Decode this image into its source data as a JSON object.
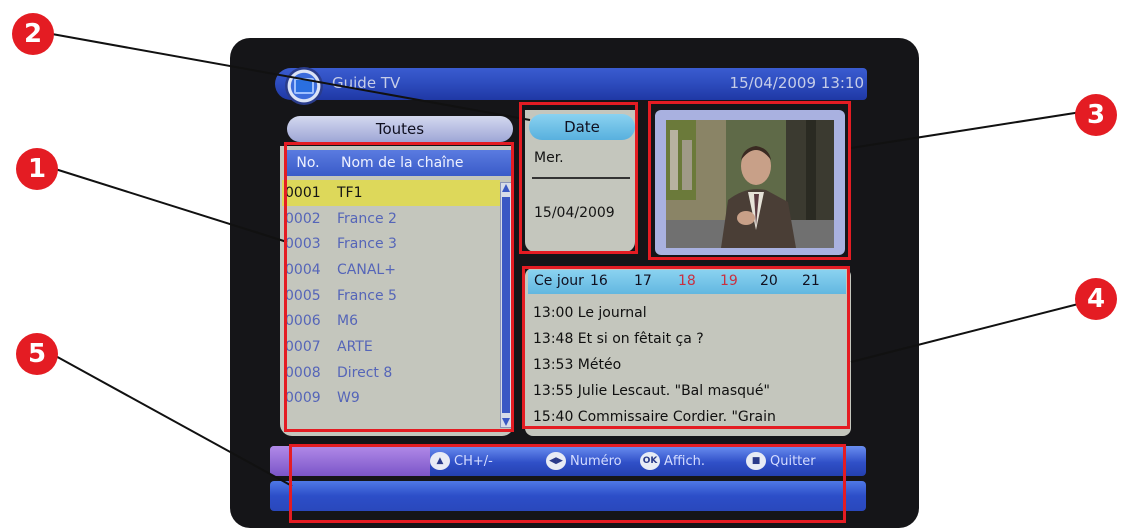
{
  "header": {
    "title": "Guide TV",
    "datetime": "15/04/2009  13:10"
  },
  "filter": {
    "label": "Toutes"
  },
  "channel_list": {
    "columns": [
      "No.",
      "Nom de la chaîne"
    ],
    "rows": [
      {
        "num": "0001",
        "name": "TF1"
      },
      {
        "num": "0002",
        "name": "France 2"
      },
      {
        "num": "0003",
        "name": "France 3"
      },
      {
        "num": "0004",
        "name": "CANAL+"
      },
      {
        "num": "0005",
        "name": "France 5"
      },
      {
        "num": "0006",
        "name": "M6"
      },
      {
        "num": "0007",
        "name": "ARTE"
      },
      {
        "num": "0008",
        "name": "Direct 8"
      },
      {
        "num": "0009",
        "name": "W9"
      }
    ],
    "selected_index": 0
  },
  "date_panel": {
    "label": "Date",
    "day": "Mer.",
    "date": "15/04/2009"
  },
  "epg": {
    "tabs": [
      "Ce jour",
      "16",
      "17",
      "18",
      "19",
      "20",
      "21"
    ],
    "programs": [
      "13:00 Le journal",
      "13:48 Et si on fêtait ça ?",
      "13:53 Météo",
      "13:55 Julie Lescaut. \"Bal masqué\"",
      "15:40 Commissaire Cordier. \"Grain"
    ]
  },
  "footer": {
    "hints": [
      {
        "icon": "up-down-icon",
        "label": "CH+/-"
      },
      {
        "icon": "left-right-icon",
        "label": "Numéro"
      },
      {
        "icon": "ok-icon",
        "label": "Affich."
      },
      {
        "icon": "exit-icon",
        "label": "Quitter"
      }
    ],
    "ok_icon_text": "OK"
  },
  "callouts": [
    "1",
    "2",
    "3",
    "4",
    "5"
  ],
  "colors": {
    "callout_red": "#e41c23",
    "header_blue": "#2e4dbf",
    "selected_yellow": "#ddd85a",
    "panel_grey": "#c4c6bd",
    "channel_text": "#5565b8",
    "weekend_tab_red": "#c83040"
  }
}
